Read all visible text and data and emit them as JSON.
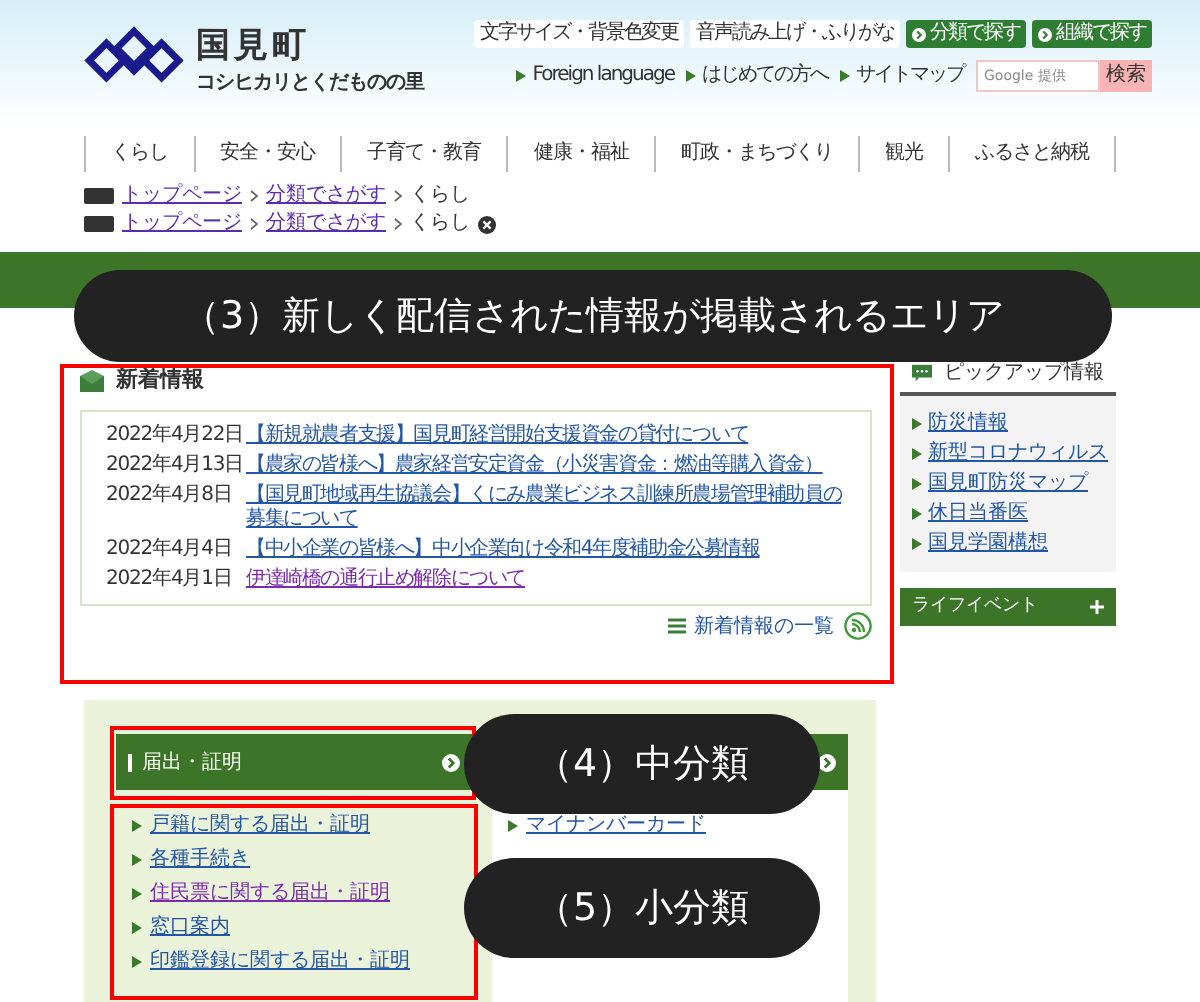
{
  "header": {
    "site_title": "国見町",
    "tagline": "コシヒカリとくだものの里",
    "utility_buttons": [
      {
        "label": "文字サイズ・背景色変更",
        "kind": "plain"
      },
      {
        "label": "音声読み上げ・ふりがな",
        "kind": "plain"
      },
      {
        "label": "分類で探す",
        "kind": "green"
      },
      {
        "label": "組織で探す",
        "kind": "green"
      }
    ],
    "links": [
      "Foreign language",
      "はじめての方へ",
      "サイトマップ"
    ],
    "search": {
      "placeholder": "Google 提供",
      "button": "検索"
    }
  },
  "nav": [
    "くらし",
    "安全・安心",
    "子育て・教育",
    "健康・福祉",
    "町政・まちづくり",
    "観光",
    "ふるさと納税"
  ],
  "breadcrumbs": [
    {
      "items": [
        "トップページ",
        "分類でさがす",
        "くらし"
      ],
      "closable": false
    },
    {
      "items": [
        "トップページ",
        "分類でさがす",
        "くらし"
      ],
      "closable": true
    }
  ],
  "callouts": [
    "（3）新しく配信された情報が掲載されるエリア",
    "（4）中分類",
    "（5）小分類"
  ],
  "news": {
    "title": "新着情報",
    "items": [
      {
        "date": "2022年4月22日",
        "title": "【新規就農者支援】国見町経営開始支援資金の貸付について",
        "visited": false
      },
      {
        "date": "2022年4月13日",
        "title": "【農家の皆様へ】農家経営安定資金（小災害資金：燃油等購入資金）",
        "visited": false
      },
      {
        "date": "2022年4月8日",
        "title": "【国見町地域再生協議会】くにみ農業ビジネス訓練所農場管理補助員の募集について",
        "visited": false
      },
      {
        "date": "2022年4月4日",
        "title": "【中小企業の皆様へ】中小企業向け令和4年度補助金公募情報",
        "visited": false
      },
      {
        "date": "2022年4月1日",
        "title": "伊達崎橋の通行止め解除について",
        "visited": true
      }
    ],
    "more_link": "新着情報の一覧"
  },
  "pickup": {
    "title": "ピックアップ情報",
    "items": [
      "防災情報",
      "新型コロナウィルス",
      "国見町防災マップ",
      "休日当番医",
      "国見学園構想"
    ]
  },
  "life_event": {
    "label": "ライフイベント",
    "expanded": false
  },
  "categories": [
    {
      "title": "届出・証明",
      "items": [
        {
          "label": "戸籍に関する届出・証明",
          "visited": false
        },
        {
          "label": "各種手続き",
          "visited": false
        },
        {
          "label": "住民票に関する届出・証明",
          "visited": true
        },
        {
          "label": "窓口案内",
          "visited": false
        },
        {
          "label": "印鑑登録に関する届出・証明",
          "visited": false
        }
      ]
    },
    {
      "items": [
        {
          "label": "マイナンバーカード",
          "visited": false
        }
      ]
    }
  ]
}
